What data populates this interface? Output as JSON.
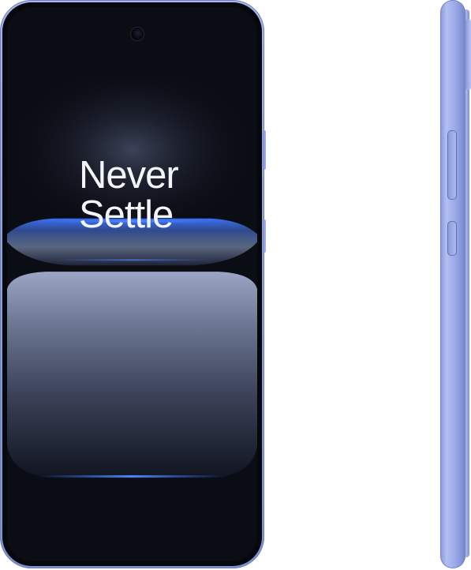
{
  "screen": {
    "headline": [
      "Never",
      "Settle"
    ]
  },
  "colors": {
    "frame": "#9aa8e2",
    "screen_dark": "#0d1018",
    "glow_blue": "#3a72ff",
    "headline_text": "#f4f5f8",
    "background": "#ffffff"
  }
}
